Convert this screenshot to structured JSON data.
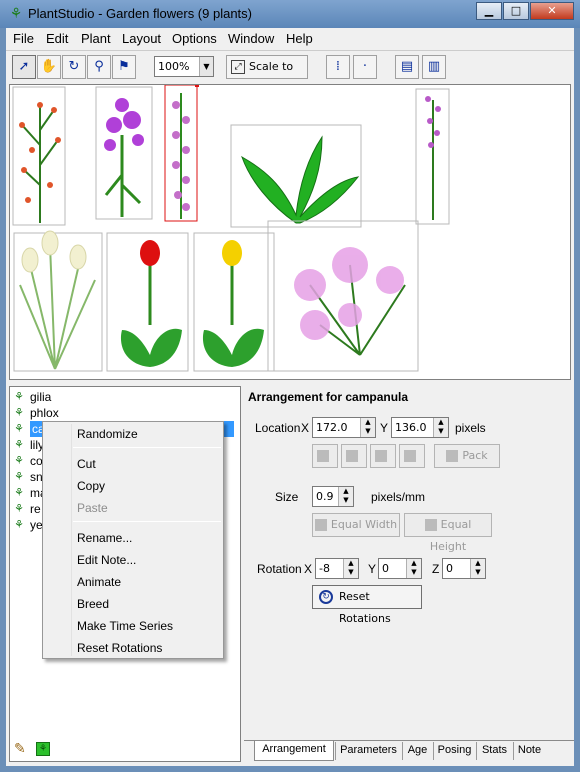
{
  "window": {
    "title": "PlantStudio - Garden flowers (9 plants)"
  },
  "menu": [
    "File",
    "Edit",
    "Plant",
    "Layout",
    "Options",
    "Window",
    "Help"
  ],
  "toolbar": {
    "zoom_value": "100%",
    "scale_to_fit": "Scale to Fit"
  },
  "plants": [
    "gilia",
    "phlox",
    "campanula",
    "lily",
    "columbine",
    "snapdragon",
    "marigold",
    "red tulip",
    "yellow tulip"
  ],
  "plant_list_visible": [
    "gilia",
    "phlox",
    "ca",
    "lily",
    "co",
    "sn",
    "ma",
    "re",
    "ye"
  ],
  "context_menu": [
    {
      "label": "Randomize",
      "enabled": true
    },
    {
      "label": "Cut",
      "enabled": true
    },
    {
      "label": "Copy",
      "enabled": true
    },
    {
      "label": "Paste",
      "enabled": false
    },
    {
      "label": "Rename...",
      "enabled": true
    },
    {
      "label": "Edit Note...",
      "enabled": true
    },
    {
      "label": "Animate",
      "enabled": true
    },
    {
      "label": "Breed",
      "enabled": true
    },
    {
      "label": "Make Time Series",
      "enabled": true
    },
    {
      "label": "Reset Rotations",
      "enabled": true
    }
  ],
  "arrangement": {
    "title": "Arrangement for campanula",
    "location_label": "Location",
    "x_label": "X",
    "x_value": "172.0",
    "y_label": "Y",
    "y_value": "136.0",
    "pixels_label": "pixels",
    "pack_label": "Pack",
    "size_label": "Size",
    "size_value": "0.9",
    "size_unit": "pixels/mm",
    "equal_width": "Equal Width",
    "equal_height": "Equal Height",
    "rotation_label": "Rotation",
    "rot_x_label": "X",
    "rot_x": "-8",
    "rot_y_label": "Y",
    "rot_y": "0",
    "rot_z_label": "Z",
    "rot_z": "0",
    "reset_rotations": "Reset Rotations"
  },
  "tabs": [
    "Arrangement",
    "Parameters",
    "Age",
    "Posing",
    "Stats",
    "Note"
  ],
  "active_tab": "Arrangement",
  "colors": {
    "selection": "#3399ff",
    "selected_box": "#dd1111",
    "plant_green": "#1d9a1d"
  }
}
